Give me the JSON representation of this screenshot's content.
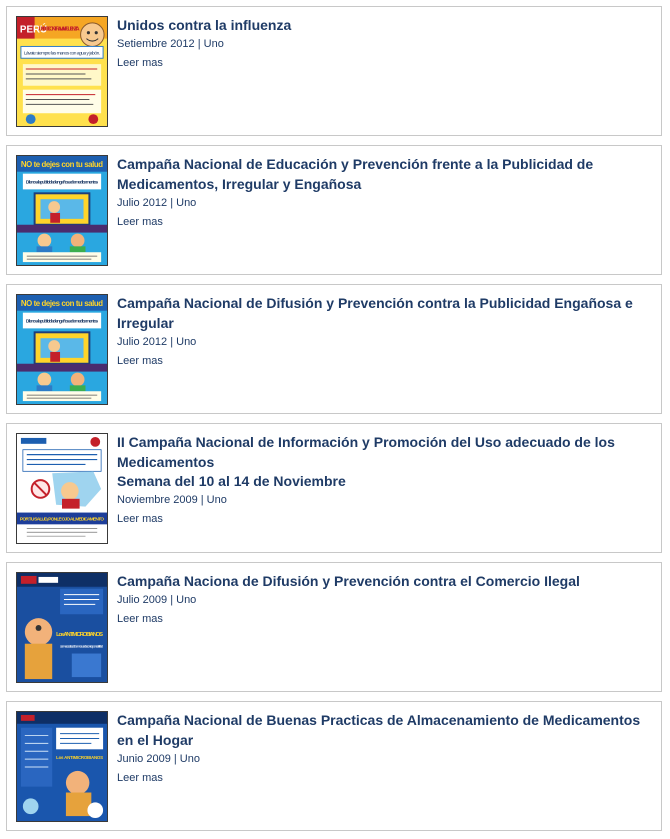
{
  "articles": [
    {
      "title": "Unidos contra la influenza",
      "subtitle": "",
      "meta": "Setiembre 2012 | Uno",
      "more": "Leer mas",
      "image_icon": "influenza-poster-icon",
      "image_text": [
        "PERÚ",
        "UNIDO CONTRA LA INFLUENZA",
        "Lávate siempre las manos con agua y jabón."
      ]
    },
    {
      "title": "Campaña Nacional de Educación y Prevención frente a la Publicidad de Medicamentos, Irregular y Engañosa",
      "subtitle": "",
      "meta": "Julio 2012 | Uno",
      "more": "Leer mas",
      "image_icon": "no-te-dejes-poster-icon",
      "image_text": [
        "NO te dejes con tu salud",
        "Dile no a la publicidad engañosa de medicamentos"
      ]
    },
    {
      "title": "Campaña Nacional de Difusión y Prevención contra la Publicidad Engañosa e Irregular",
      "subtitle": "",
      "meta": "Julio 2012 | Uno",
      "more": "Leer mas",
      "image_icon": "no-te-dejes-poster-icon",
      "image_text": [
        "NO te dejes con tu salud",
        "Dile no a la publicidad engañosa de medicamentos"
      ]
    },
    {
      "title": "II Campaña Nacional de Información y Promoción del Uso adecuado de los Medicamentos",
      "subtitle": "Semana del 10 al 14 de Noviembre",
      "meta": "Noviembre 2009 | Uno",
      "more": "Leer mas",
      "image_icon": "uso-adecuado-poster-icon",
      "image_text": [
        "POR TU SALUD, PONLE OJO AL MEDICAMENTO"
      ]
    },
    {
      "title": "Campaña Naciona de Difusión y Prevención contra el Comercio Ilegal",
      "subtitle": "",
      "meta": "Julio 2009 | Uno",
      "more": "Leer mas",
      "image_icon": "antimicrobianos-poster-icon",
      "image_text": [
        "Los ANTIMICROBIANOS",
        "son necesarios... debemos usarlos con responsabilidad"
      ]
    },
    {
      "title": "Campaña Nacional de Buenas Practicas de Almacenamiento de Medicamentos en el Hogar",
      "subtitle": "",
      "meta": "Junio 2009 | Uno",
      "more": "Leer mas",
      "image_icon": "almacenamiento-poster-icon",
      "image_text": [
        "Los ANTIMICROBIANOS"
      ]
    }
  ]
}
